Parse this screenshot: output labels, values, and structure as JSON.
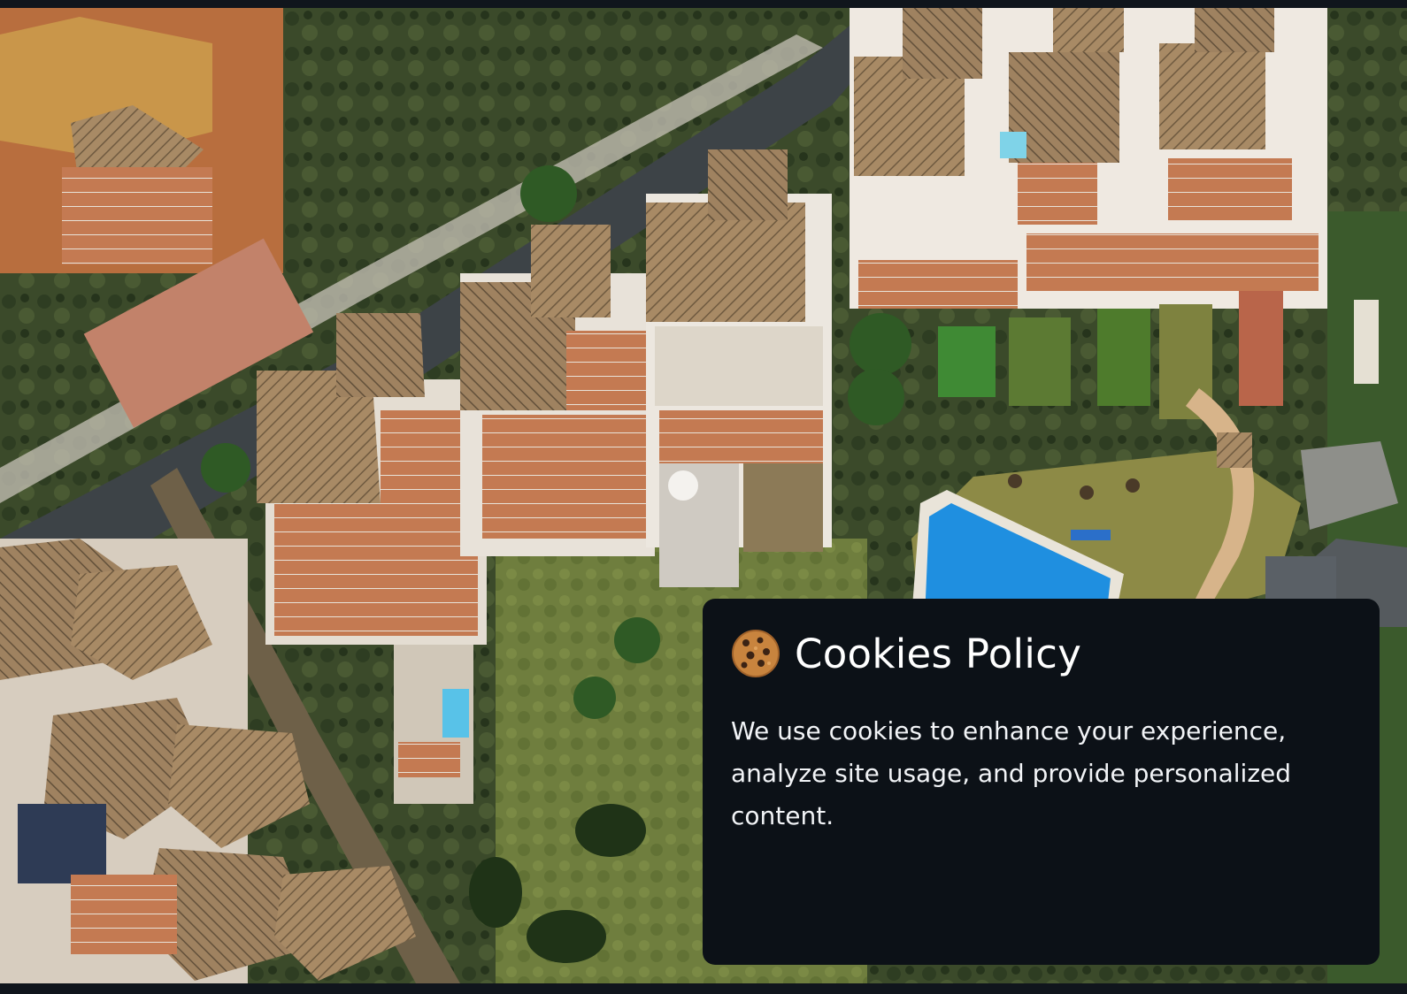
{
  "cookie_banner": {
    "icon": "cookie-icon",
    "title": "Cookies Policy",
    "message": "We use cookies to enhance your experience, analyze site usage, and provide personalized content."
  },
  "hero": {
    "image": "aerial view of hillside residential complex with pool"
  },
  "colors": {
    "banner_bg": "#0c1117",
    "banner_text": "#ffffff",
    "page_bg": "#0d1117"
  }
}
